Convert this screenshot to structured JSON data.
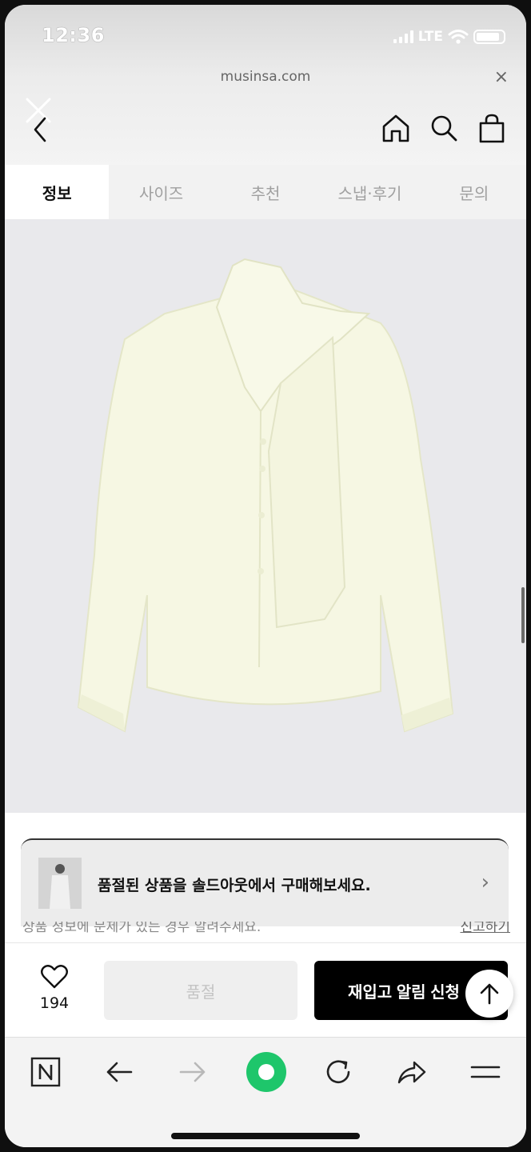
{
  "status_bar": {
    "time": "12:36",
    "network": "LTE"
  },
  "browser": {
    "url": "musinsa.com",
    "close_label": "×"
  },
  "tabs": [
    {
      "label": "정보",
      "active": true
    },
    {
      "label": "사이즈",
      "active": false
    },
    {
      "label": "추천",
      "active": false
    },
    {
      "label": "스냅·후기",
      "active": false
    },
    {
      "label": "문의",
      "active": false
    }
  ],
  "header_icons": [
    "close-icon",
    "back-icon",
    "home-icon",
    "search-icon",
    "shopping-bag-icon"
  ],
  "banner": {
    "text": "품절된 상품을 솔드아웃에서 구매해보세요.",
    "arrow": "›"
  },
  "notice": {
    "text": "상품 정보에 문제가 있는 경우 알려주세요.",
    "report_link": "신고하기"
  },
  "action_bar": {
    "like_count": "194",
    "soldout_label": "품절",
    "restock_label": "재입고 알림 신청"
  },
  "colors": {
    "accent_green": "#1ec66b",
    "primary_black": "#000000",
    "garment": "#f6f7e3"
  },
  "toolbar_icons": [
    "naver-icon",
    "back-arrow-icon",
    "forward-arrow-icon",
    "green-dot-icon",
    "refresh-icon",
    "share-icon",
    "menu-icon"
  ]
}
